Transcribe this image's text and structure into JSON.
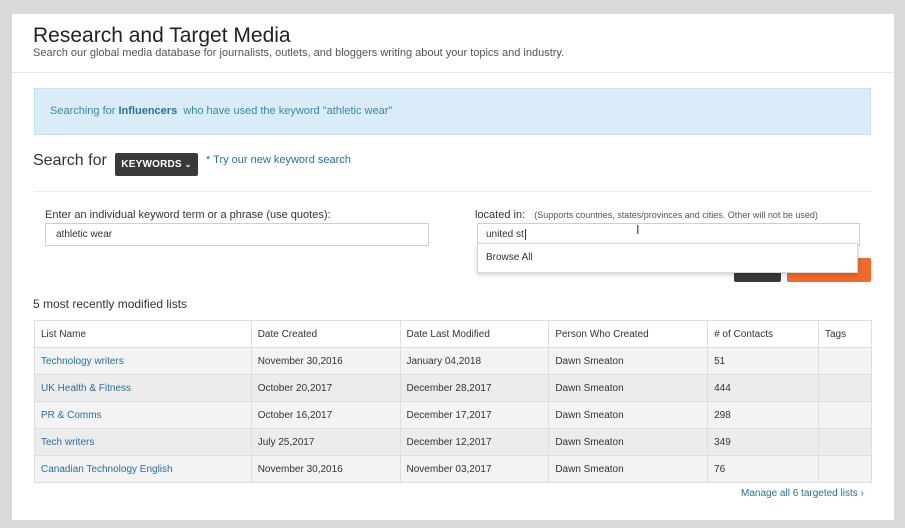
{
  "header": {
    "title": "Research and Target Media",
    "subtitle": "Search our global media database for journalists, outlets, and bloggers writing about your topics and industry."
  },
  "banner": {
    "prefix": "Searching for",
    "entity": "Influencers",
    "suffix": "who have used the keyword \"athletic wear\""
  },
  "search": {
    "label": "Search for",
    "mode_button": "KEYWORDS",
    "try_link": "* Try our new keyword search",
    "keyword_label": "Enter an individual keyword term or a phrase (use quotes):",
    "keyword_value": "athletic wear",
    "location_label": "located in:",
    "location_hint": "(Supports countries, states/provinces and cities. Other will not be used)",
    "location_value": "united st",
    "dropdown_option": "Browse All"
  },
  "recent": {
    "heading": "5 most recently modified lists",
    "columns": [
      "List Name",
      "Date Created",
      "Date Last Modified",
      "Person Who Created",
      "# of Contacts",
      "Tags"
    ],
    "rows": [
      {
        "name": "Technology writers",
        "created": "November 30,2016",
        "modified": "January 04,2018",
        "creator": "Dawn Smeaton",
        "contacts": "51",
        "tags": ""
      },
      {
        "name": "UK Health & Fitness",
        "created": "October 20,2017",
        "modified": "December 28,2017",
        "creator": "Dawn Smeaton",
        "contacts": "444",
        "tags": ""
      },
      {
        "name": "PR & Comms",
        "created": "October 16,2017",
        "modified": "December 17,2017",
        "creator": "Dawn Smeaton",
        "contacts": "298",
        "tags": ""
      },
      {
        "name": "Tech writers",
        "created": "July 25,2017",
        "modified": "December 12,2017",
        "creator": "Dawn Smeaton",
        "contacts": "349",
        "tags": ""
      },
      {
        "name": "Canadian Technology English",
        "created": "November 30,2016",
        "modified": "November 03,2017",
        "creator": "Dawn Smeaton",
        "contacts": "76",
        "tags": ""
      }
    ],
    "manage_link": "Manage all 6 targeted lists"
  },
  "colors": {
    "accent": "#2a6f99",
    "banner_bg": "#d9ecf7",
    "dark_button": "#3a3a3a",
    "orange_button": "#f26a2a"
  }
}
